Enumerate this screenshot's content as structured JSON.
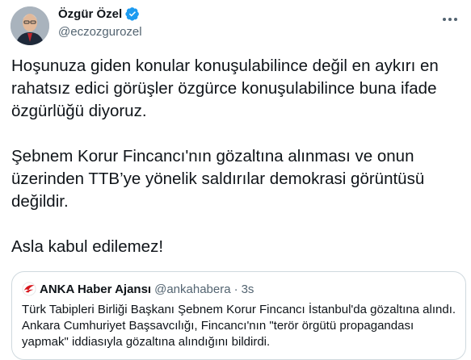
{
  "author": {
    "name": "Özgür Özel",
    "handle": "@eczozgurozel"
  },
  "tweet": {
    "paragraphs": [
      "Hoşunuza giden konular konuşulabilince değil en aykırı en rahatsız edici görüşler özgürce konuşulabilince buna ifade özgürlüğü diyoruz.",
      "Şebnem Korur Fincancı'nın gözaltına alınması ve onun üzerinden TTB’ye yönelik saldırılar demokrasi görüntüsü değildir.",
      "Asla kabul edilemez!"
    ]
  },
  "quote": {
    "name": "ANKA Haber Ajansı",
    "handle": "@ankahabera",
    "separator": "·",
    "time": "3s",
    "text": "Türk Tabipleri Birliği Başkanı Şebnem Korur Fincancı İstanbul'da gözaltına alındı. Ankara Cumhuriyet Başsavcılığı, Fincancı'nın \"terör örgütü propagandası yapmak\" iddiasıyla gözaltına alındığını bildirdi."
  },
  "colors": {
    "verified": "#1d9bf0",
    "secondary_text": "#536471",
    "border": "#cfd9de",
    "anka_red": "#d7141a"
  },
  "icons": {
    "verified": "verified-badge-icon",
    "more": "more-options-icon"
  }
}
